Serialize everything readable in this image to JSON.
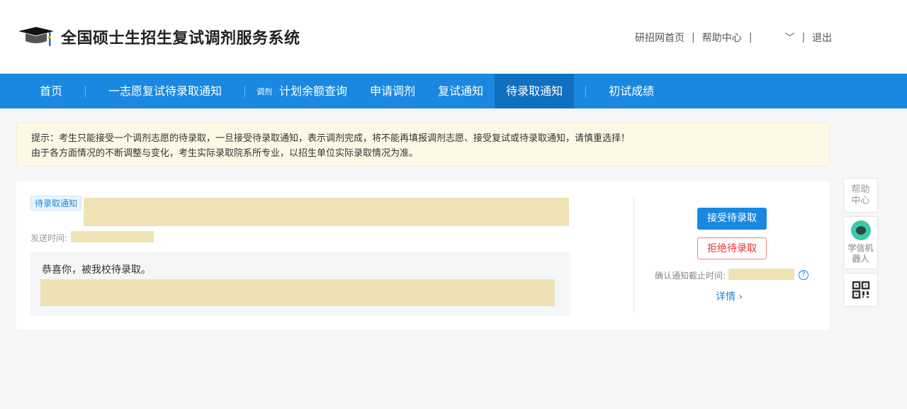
{
  "header": {
    "title": "全国硕士生招生复试调剂服务系统",
    "links": [
      "研招网首页",
      "帮助中心",
      "退出"
    ]
  },
  "nav": {
    "items": [
      "首页",
      "一志愿复试待录取通知",
      "调剂",
      "计划余额查询",
      "申请调剂",
      "复试通知",
      "待录取通知",
      "初试成绩"
    ],
    "active": "待录取通知"
  },
  "notice": {
    "line1": "提示：考生只能接受一个调剂志愿的待录取，一旦接受待录取通知，表示调剂完成，将不能再填报调剂志愿、接受复试或待录取通知，请慎重选择！",
    "line2": "由于各方面情况的不断调整与变化，考生实际录取院系所专业，以招生单位实际录取情况为准。"
  },
  "card": {
    "tag": "待录取通知",
    "send_time_label": "发送时间:",
    "message": "恭喜你，被我校待录取。",
    "accept_label": "接受待录取",
    "reject_label": "拒绝待录取",
    "deadline_label": "确认通知截止时间:",
    "details_label": "详情"
  },
  "sidebar": {
    "help": "帮助中心",
    "robot": "学信机器人"
  },
  "colors": {
    "primary": "#1a88e0",
    "danger": "#e33333",
    "notice_bg": "#fdf7e5"
  }
}
